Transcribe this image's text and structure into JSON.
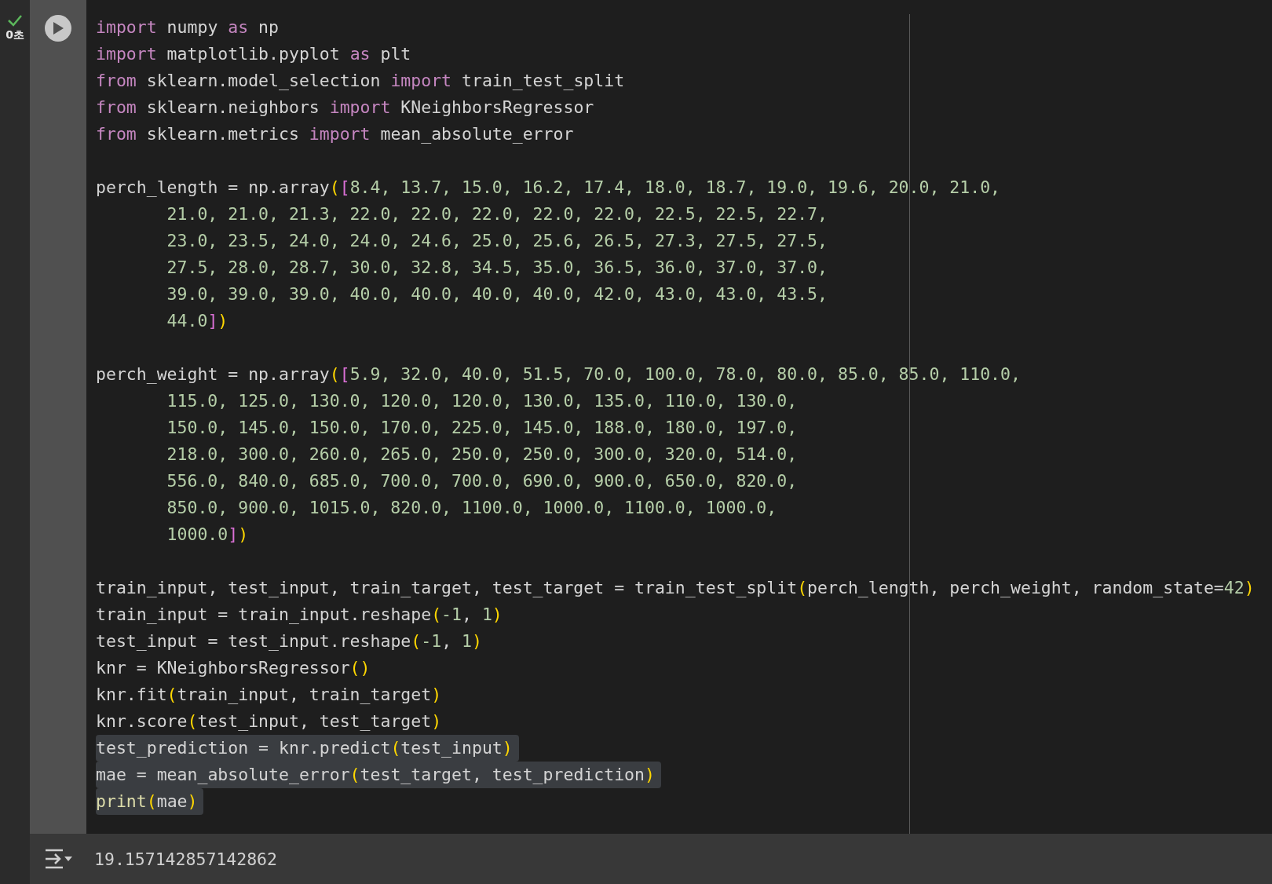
{
  "cell": {
    "status": {
      "done": true,
      "time": "0초"
    },
    "blocks": [
      {
        "lines": [
          {
            "selected": false,
            "indent": false,
            "tokens": [
              {
                "kind": "kw",
                "text": "import"
              },
              {
                "kind": "plain",
                "text": " numpy "
              },
              {
                "kind": "kw",
                "text": "as"
              },
              {
                "kind": "plain",
                "text": " np"
              }
            ]
          },
          {
            "selected": false,
            "indent": false,
            "tokens": [
              {
                "kind": "kw",
                "text": "import"
              },
              {
                "kind": "plain",
                "text": " matplotlib.pyplot "
              },
              {
                "kind": "kw",
                "text": "as"
              },
              {
                "kind": "plain",
                "text": " plt"
              }
            ]
          },
          {
            "selected": false,
            "indent": false,
            "tokens": [
              {
                "kind": "kw",
                "text": "from"
              },
              {
                "kind": "plain",
                "text": " sklearn.model_selection "
              },
              {
                "kind": "kw",
                "text": "import"
              },
              {
                "kind": "plain",
                "text": " train_test_split"
              }
            ]
          },
          {
            "selected": false,
            "indent": false,
            "tokens": [
              {
                "kind": "kw",
                "text": "from"
              },
              {
                "kind": "plain",
                "text": " sklearn.neighbors "
              },
              {
                "kind": "kw",
                "text": "import"
              },
              {
                "kind": "plain",
                "text": " KNeighborsRegressor"
              }
            ]
          },
          {
            "selected": false,
            "indent": false,
            "tokens": [
              {
                "kind": "kw",
                "text": "from"
              },
              {
                "kind": "plain",
                "text": " sklearn.metrics "
              },
              {
                "kind": "kw",
                "text": "import"
              },
              {
                "kind": "plain",
                "text": " mean_absolute_error"
              }
            ]
          }
        ]
      },
      {
        "lines": [
          {
            "selected": false,
            "indent": false,
            "tokens": [
              {
                "kind": "plain",
                "text": "perch_length = np.array"
              },
              {
                "kind": "bracket",
                "text": "("
              },
              {
                "kind": "bracket2",
                "text": "["
              },
              {
                "kind": "num",
                "text": "8.4, 13.7, 15.0, 16.2, 17.4, 18.0, 18.7, 19.0, 19.6, 20.0, 21.0,"
              }
            ]
          },
          {
            "selected": false,
            "indent": true,
            "tokens": [
              {
                "kind": "num",
                "text": "21.0, 21.0, 21.3, 22.0, 22.0, 22.0, 22.0, 22.0, 22.5, 22.5, 22.7,"
              }
            ]
          },
          {
            "selected": false,
            "indent": true,
            "tokens": [
              {
                "kind": "num",
                "text": "23.0, 23.5, 24.0, 24.0, 24.6, 25.0, 25.6, 26.5, 27.3, 27.5, 27.5,"
              }
            ]
          },
          {
            "selected": false,
            "indent": true,
            "tokens": [
              {
                "kind": "num",
                "text": "27.5, 28.0, 28.7, 30.0, 32.8, 34.5, 35.0, 36.5, 36.0, 37.0, 37.0,"
              }
            ]
          },
          {
            "selected": false,
            "indent": true,
            "tokens": [
              {
                "kind": "num",
                "text": "39.0, 39.0, 39.0, 40.0, 40.0, 40.0, 40.0, 42.0, 43.0, 43.0, 43.5,"
              }
            ]
          },
          {
            "selected": false,
            "indent": true,
            "tokens": [
              {
                "kind": "num",
                "text": "44.0"
              },
              {
                "kind": "bracket2",
                "text": "]"
              },
              {
                "kind": "bracket",
                "text": ")"
              }
            ]
          }
        ]
      },
      {
        "lines": [
          {
            "selected": false,
            "indent": false,
            "tokens": [
              {
                "kind": "plain",
                "text": "perch_weight = np.array"
              },
              {
                "kind": "bracket",
                "text": "("
              },
              {
                "kind": "bracket2",
                "text": "["
              },
              {
                "kind": "num",
                "text": "5.9, 32.0, 40.0, 51.5, 70.0, 100.0, 78.0, 80.0, 85.0, 85.0, 110.0,"
              }
            ]
          },
          {
            "selected": false,
            "indent": true,
            "tokens": [
              {
                "kind": "num",
                "text": "115.0, 125.0, 130.0, 120.0, 120.0, 130.0, 135.0, 110.0, 130.0,"
              }
            ]
          },
          {
            "selected": false,
            "indent": true,
            "tokens": [
              {
                "kind": "num",
                "text": "150.0, 145.0, 150.0, 170.0, 225.0, 145.0, 188.0, 180.0, 197.0,"
              }
            ]
          },
          {
            "selected": false,
            "indent": true,
            "tokens": [
              {
                "kind": "num",
                "text": "218.0, 300.0, 260.0, 265.0, 250.0, 250.0, 300.0, 320.0, 514.0,"
              }
            ]
          },
          {
            "selected": false,
            "indent": true,
            "tokens": [
              {
                "kind": "num",
                "text": "556.0, 840.0, 685.0, 700.0, 700.0, 690.0, 900.0, 650.0, 820.0,"
              }
            ]
          },
          {
            "selected": false,
            "indent": true,
            "tokens": [
              {
                "kind": "num",
                "text": "850.0, 900.0, 1015.0, 820.0, 1100.0, 1000.0, 1100.0, 1000.0,"
              }
            ]
          },
          {
            "selected": false,
            "indent": true,
            "tokens": [
              {
                "kind": "num",
                "text": "1000.0"
              },
              {
                "kind": "bracket2",
                "text": "]"
              },
              {
                "kind": "bracket",
                "text": ")"
              }
            ]
          }
        ]
      },
      {
        "lines": [
          {
            "selected": false,
            "indent": false,
            "tokens": [
              {
                "kind": "plain",
                "text": "train_input, test_input, train_target, test_target = train_test_split"
              },
              {
                "kind": "bracket",
                "text": "("
              },
              {
                "kind": "plain",
                "text": "perch_length, perch_weight, random_state="
              },
              {
                "kind": "num",
                "text": "42"
              },
              {
                "kind": "bracket",
                "text": ")"
              }
            ]
          },
          {
            "selected": false,
            "indent": false,
            "tokens": [
              {
                "kind": "plain",
                "text": "train_input = train_input.reshape"
              },
              {
                "kind": "bracket",
                "text": "("
              },
              {
                "kind": "num",
                "text": "-1"
              },
              {
                "kind": "plain",
                "text": ", "
              },
              {
                "kind": "num",
                "text": "1"
              },
              {
                "kind": "bracket",
                "text": ")"
              }
            ]
          },
          {
            "selected": false,
            "indent": false,
            "tokens": [
              {
                "kind": "plain",
                "text": "test_input = test_input.reshape"
              },
              {
                "kind": "bracket",
                "text": "("
              },
              {
                "kind": "num",
                "text": "-1"
              },
              {
                "kind": "plain",
                "text": ", "
              },
              {
                "kind": "num",
                "text": "1"
              },
              {
                "kind": "bracket",
                "text": ")"
              }
            ]
          },
          {
            "selected": false,
            "indent": false,
            "tokens": [
              {
                "kind": "plain",
                "text": "knr = KNeighborsRegressor"
              },
              {
                "kind": "bracket",
                "text": "()"
              }
            ]
          },
          {
            "selected": false,
            "indent": false,
            "tokens": [
              {
                "kind": "plain",
                "text": "knr.fit"
              },
              {
                "kind": "bracket",
                "text": "("
              },
              {
                "kind": "plain",
                "text": "train_input, train_target"
              },
              {
                "kind": "bracket",
                "text": ")"
              }
            ]
          },
          {
            "selected": false,
            "indent": false,
            "tokens": [
              {
                "kind": "plain",
                "text": "knr.score"
              },
              {
                "kind": "bracket",
                "text": "("
              },
              {
                "kind": "plain",
                "text": "test_input, test_target"
              },
              {
                "kind": "bracket",
                "text": ")"
              }
            ]
          },
          {
            "selected": true,
            "indent": false,
            "tokens": [
              {
                "kind": "plain",
                "text": "test_prediction = knr.predict"
              },
              {
                "kind": "bracket",
                "text": "("
              },
              {
                "kind": "plain",
                "text": "test_input"
              },
              {
                "kind": "bracket",
                "text": ")"
              }
            ]
          },
          {
            "selected": true,
            "indent": false,
            "tokens": [
              {
                "kind": "plain",
                "text": "mae = mean_absolute_error"
              },
              {
                "kind": "bracket",
                "text": "("
              },
              {
                "kind": "plain",
                "text": "test_target, test_prediction"
              },
              {
                "kind": "bracket",
                "text": ")"
              }
            ]
          },
          {
            "selected": true,
            "indent": false,
            "tokens": [
              {
                "kind": "fn",
                "text": "print"
              },
              {
                "kind": "bracket",
                "text": "("
              },
              {
                "kind": "plain",
                "text": "mae"
              },
              {
                "kind": "bracket",
                "text": ")"
              }
            ]
          }
        ]
      }
    ],
    "output": {
      "text": "19.157142857142862"
    }
  }
}
